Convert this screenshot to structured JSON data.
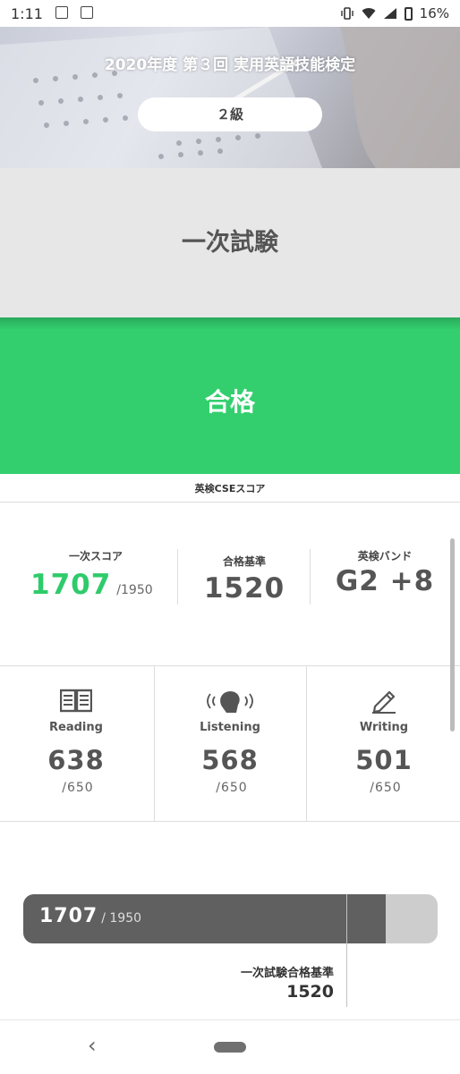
{
  "status_bar": {
    "time": "1:11",
    "battery": "16%"
  },
  "header": {
    "title": "2020年度 第３回 実用英語技能検定",
    "grade": "２級"
  },
  "exam": {
    "stage": "一次試験",
    "result": "合格",
    "result_color": "#33cf6e"
  },
  "cse": {
    "section_label": "英検CSEスコア",
    "score_label": "一次スコア",
    "score": "1707",
    "score_max": "/1950",
    "pass_label": "合格基準",
    "pass_score": "1520",
    "band_label": "英検バンド",
    "band": "G2 +8"
  },
  "skills": [
    {
      "name": "Reading",
      "icon": "book-icon",
      "score": "638",
      "max": "/650"
    },
    {
      "name": "Listening",
      "icon": "head-sound-icon",
      "score": "568",
      "max": "/650"
    },
    {
      "name": "Writing",
      "icon": "pencil-icon",
      "score": "501",
      "max": "/650"
    }
  ],
  "progress": {
    "value": 1707,
    "max": 1950,
    "value_text": "1707",
    "max_text": "/ 1950",
    "threshold": 1520,
    "threshold_label": "一次試験合格基準",
    "threshold_text": "1520"
  },
  "nav": {
    "back_icon": "back-chevron-icon",
    "home_icon": "home-pill-icon"
  }
}
